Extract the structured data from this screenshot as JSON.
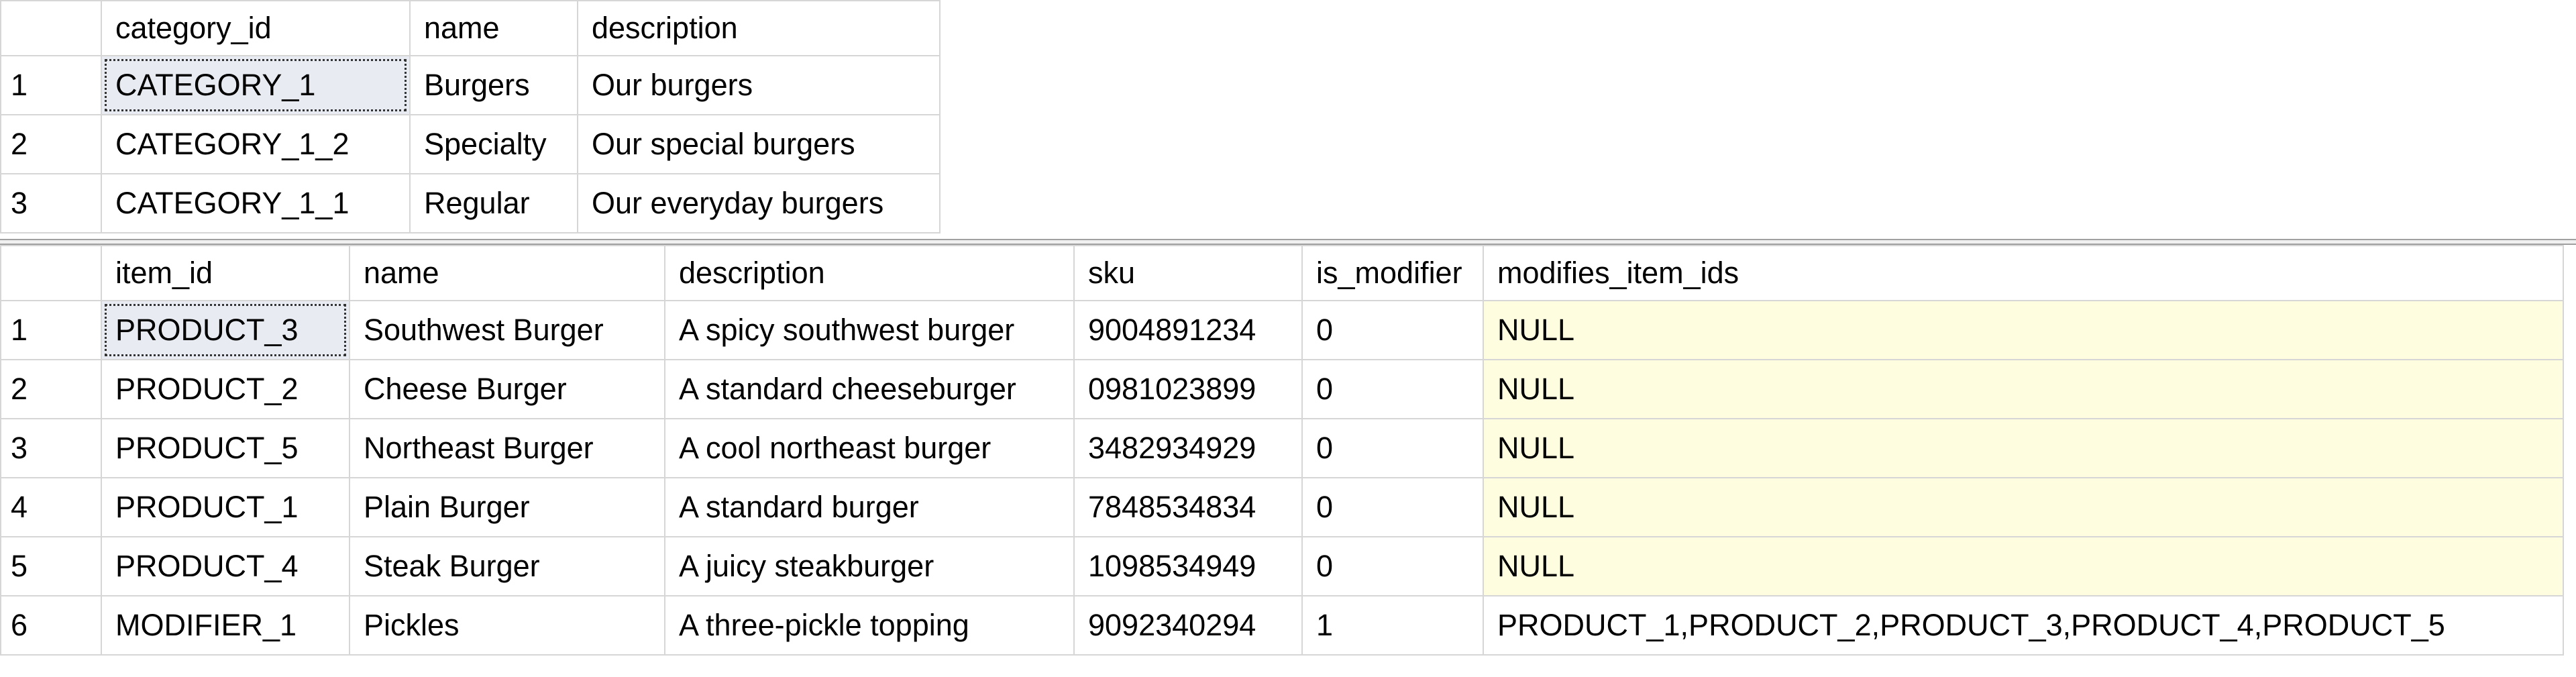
{
  "categories": {
    "columns": [
      "",
      "category_id",
      "name",
      "description"
    ],
    "rows": [
      {
        "n": "1",
        "category_id": "CATEGORY_1",
        "name": "Burgers",
        "description": "Our burgers"
      },
      {
        "n": "2",
        "category_id": "CATEGORY_1_2",
        "name": "Specialty",
        "description": "Our special burgers"
      },
      {
        "n": "3",
        "category_id": "CATEGORY_1_1",
        "name": "Regular",
        "description": "Our everyday burgers"
      }
    ]
  },
  "items": {
    "columns": [
      "",
      "item_id",
      "name",
      "description",
      "sku",
      "is_modifier",
      "modifies_item_ids"
    ],
    "rows": [
      {
        "n": "1",
        "item_id": "PRODUCT_3",
        "name": "Southwest Burger",
        "description": "A spicy southwest burger",
        "sku": "9004891234",
        "is_modifier": "0",
        "modifies_item_ids": "NULL"
      },
      {
        "n": "2",
        "item_id": "PRODUCT_2",
        "name": "Cheese Burger",
        "description": "A standard cheeseburger",
        "sku": "0981023899",
        "is_modifier": "0",
        "modifies_item_ids": "NULL"
      },
      {
        "n": "3",
        "item_id": "PRODUCT_5",
        "name": "Northeast Burger",
        "description": "A cool northeast burger",
        "sku": "3482934929",
        "is_modifier": "0",
        "modifies_item_ids": "NULL"
      },
      {
        "n": "4",
        "item_id": "PRODUCT_1",
        "name": "Plain Burger",
        "description": "A standard burger",
        "sku": "7848534834",
        "is_modifier": "0",
        "modifies_item_ids": "NULL"
      },
      {
        "n": "5",
        "item_id": "PRODUCT_4",
        "name": "Steak Burger",
        "description": "A juicy steakburger",
        "sku": "1098534949",
        "is_modifier": "0",
        "modifies_item_ids": "NULL"
      },
      {
        "n": "6",
        "item_id": "MODIFIER_1",
        "name": "Pickles",
        "description": "A three-pickle topping",
        "sku": "9092340294",
        "is_modifier": "1",
        "modifies_item_ids": "PRODUCT_1,PRODUCT_2,PRODUCT_3,PRODUCT_4,PRODUCT_5"
      }
    ]
  },
  "colors": {
    "null_cell_bg": "#fffde0",
    "selected_cell_bg": "#e8ecf2",
    "grid_line": "#d6d6d6"
  }
}
